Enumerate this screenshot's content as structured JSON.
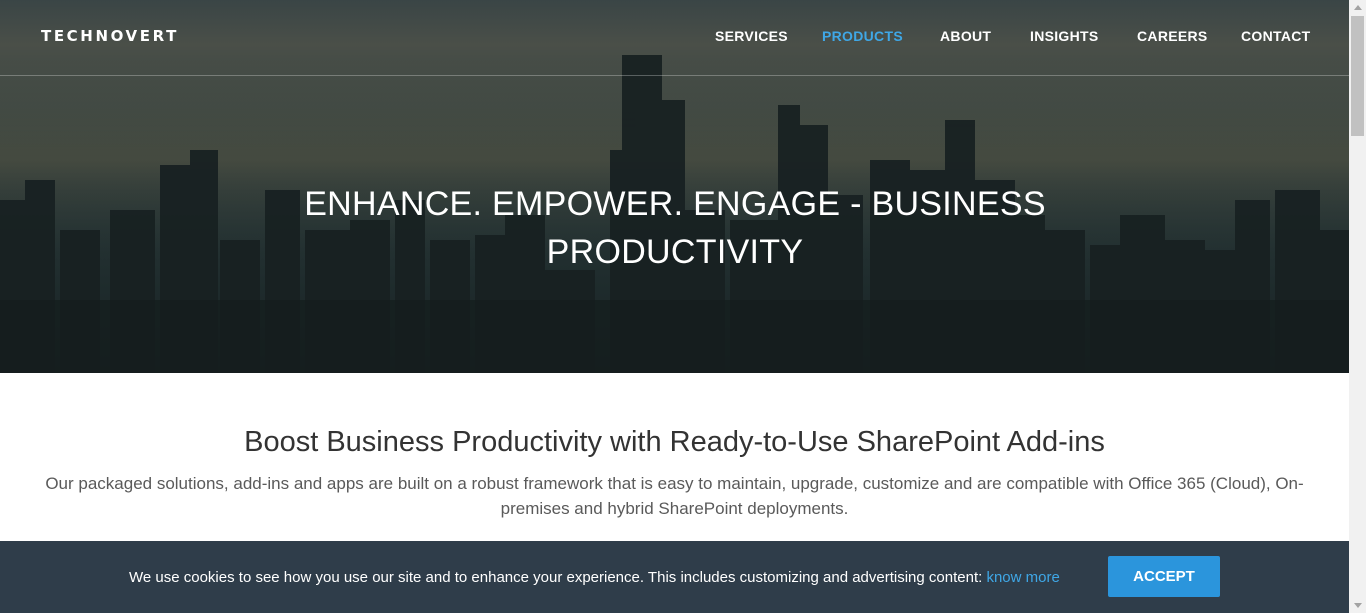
{
  "header": {
    "logo": "TECHNOVERT",
    "nav": [
      {
        "label": "SERVICES",
        "active": false
      },
      {
        "label": "PRODUCTS",
        "active": true
      },
      {
        "label": "ABOUT",
        "active": false
      },
      {
        "label": "INSIGHTS",
        "active": false
      },
      {
        "label": "CAREERS",
        "active": false
      },
      {
        "label": "CONTACT",
        "active": false
      }
    ]
  },
  "hero": {
    "title": "ENHANCE. EMPOWER. ENGAGE - BUSINESS PRODUCTIVITY"
  },
  "intro": {
    "heading": "Boost Business Productivity with Ready-to-Use SharePoint Add-ins",
    "description": "Our packaged solutions, add-ins and apps are built on a robust framework that is easy to maintain, upgrade, customize and are compatible with Office 365 (Cloud), On-premises and hybrid SharePoint deployments."
  },
  "cookie_banner": {
    "text": "We use cookies to see how you use our site and to enhance your experience. This includes customizing and advertising content:",
    "link_label": "know more",
    "accept_label": "ACCEPT"
  },
  "colors": {
    "accent": "#3fa7e6",
    "button": "#2b95dc",
    "banner_bg": "#2f3d4a"
  }
}
